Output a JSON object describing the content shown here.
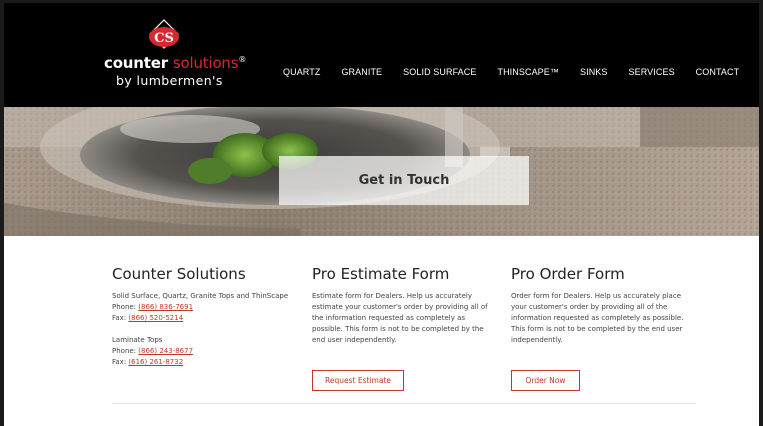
{
  "logo": {
    "monogram": "CS",
    "name_part1": "counter",
    "name_part2": "solutions",
    "registered": "®",
    "tagline": "by lumbermen's"
  },
  "nav": {
    "items": [
      "QUARTZ",
      "GRANITE",
      "SOLID SURFACE",
      "THINSCAPE™",
      "SINKS",
      "SERVICES",
      "CONTACT"
    ]
  },
  "hero": {
    "title": "Get in Touch"
  },
  "columns": {
    "counter": {
      "heading": "Counter Solutions",
      "line1": "Solid Surface, Quartz, Granite Tops and ThinScape",
      "phone1_label": "Phone: ",
      "phone1": "(866) 836-7691",
      "fax1_label": "Fax: ",
      "fax1": "(866) 520-5214",
      "section2": "Laminate Tops",
      "phone2_label": "Phone: ",
      "phone2": "(866) 243-8677",
      "fax2_label": "Fax: ",
      "fax2": "(616) 261-8732"
    },
    "estimate": {
      "heading": "Pro Estimate Form",
      "body": "Estimate form for Dealers. Help us accurately estimate your customer's order by providing all of the information requested as completely as possible. This form is not to be completed by the end user independently.",
      "button": "Request Estimate"
    },
    "order": {
      "heading": "Pro Order Form",
      "body": "Order form for Dealers. Help us accurately place your customer's order by providing all of the information requested as completely as possible. This form is not to be completed by the end user independently.",
      "button": "Order Now"
    }
  },
  "colors": {
    "header_bg": "#000000",
    "accent_red": "#c0392b",
    "logo_red": "#d7272f"
  }
}
